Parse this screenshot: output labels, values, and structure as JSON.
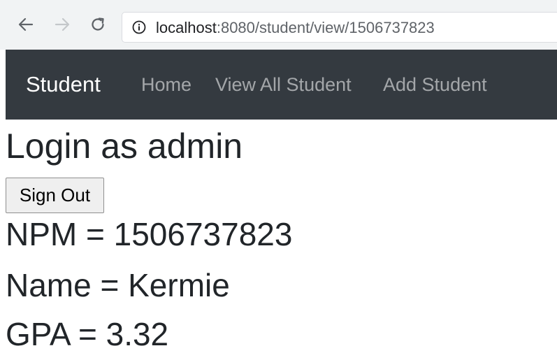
{
  "browser": {
    "address": {
      "host": "localhost",
      "rest": ":8080/student/view/1506737823"
    }
  },
  "navbar": {
    "brand": "Student",
    "links": [
      "Home",
      "View All Student",
      "Add Student"
    ]
  },
  "main": {
    "heading": "Login as admin",
    "signout_label": "Sign Out",
    "lines": [
      "NPM = 1506737823",
      "Name = Kermie",
      "GPA = 3.32"
    ]
  },
  "colors": {
    "navbar_bg": "#343a40",
    "brand": "#ffffff",
    "nav_link": "#9a9da0",
    "text": "#212529"
  }
}
